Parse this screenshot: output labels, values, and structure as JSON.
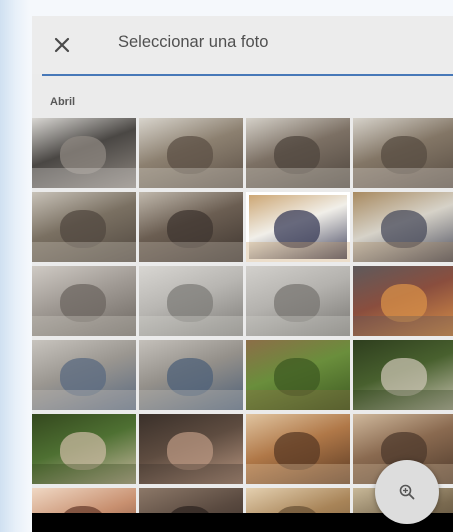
{
  "header": {
    "title": "Seleccionar una foto"
  },
  "section": {
    "month": "Abril"
  },
  "icons": {
    "close": "close-icon",
    "zoom": "zoom-in-icon"
  },
  "colors": {
    "divider": "#4778b8",
    "background": "#ebebeb"
  },
  "photos": [
    {
      "name": "photo-cat-on-floor",
      "selected": false,
      "colors": [
        "#4a4744",
        "#8e8780",
        "#d9d7d3"
      ]
    },
    {
      "name": "photo-cat-sleeping",
      "selected": false,
      "colors": [
        "#8c8070",
        "#5c5046",
        "#d8d4cc"
      ]
    },
    {
      "name": "photo-cat-on-blanket",
      "selected": false,
      "colors": [
        "#7c7064",
        "#4f463e",
        "#d4d0c8"
      ]
    },
    {
      "name": "photo-cat-resting",
      "selected": false,
      "colors": [
        "#837666",
        "#574c42",
        "#d6d2ca"
      ]
    },
    {
      "name": "photo-cat-lying",
      "selected": false,
      "colors": [
        "#7a7062",
        "#514840",
        "#c8c2b8"
      ]
    },
    {
      "name": "photo-cat-closeup",
      "selected": false,
      "colors": [
        "#6b5e52",
        "#3f3630",
        "#c0b8ac"
      ]
    },
    {
      "name": "photo-drawing-on-paper",
      "selected": true,
      "colors": [
        "#f1efe9",
        "#3a3c58",
        "#c9a06a"
      ]
    },
    {
      "name": "photo-drawing-figures",
      "selected": false,
      "colors": [
        "#d6d2c8",
        "#4a4c5c",
        "#a88a60"
      ]
    },
    {
      "name": "photo-room-doorway",
      "selected": false,
      "colors": [
        "#a09a94",
        "#6c6660",
        "#cfcac4"
      ]
    },
    {
      "name": "photo-window-blinds",
      "selected": false,
      "colors": [
        "#b8b6b2",
        "#7e7c78",
        "#d8d6d2"
      ]
    },
    {
      "name": "photo-window-blinds-2",
      "selected": false,
      "colors": [
        "#b4b2ae",
        "#787672",
        "#d2d0cc"
      ]
    },
    {
      "name": "photo-shelf-items",
      "selected": false,
      "colors": [
        "#8a4e3e",
        "#d89048",
        "#5e5a5c"
      ]
    },
    {
      "name": "photo-person-bending",
      "selected": false,
      "colors": [
        "#9a9690",
        "#5a6a80",
        "#c8c4be"
      ]
    },
    {
      "name": "photo-person-cleaning",
      "selected": false,
      "colors": [
        "#94908a",
        "#4e6078",
        "#c4c0ba"
      ]
    },
    {
      "name": "photo-plant-leaves",
      "selected": false,
      "colors": [
        "#6a8e3c",
        "#3e5a22",
        "#8c6e48"
      ]
    },
    {
      "name": "photo-plant-closeup",
      "selected": false,
      "colors": [
        "#48602e",
        "#c8c2b0",
        "#2e3e1e"
      ]
    },
    {
      "name": "photo-cat-in-grass",
      "selected": false,
      "colors": [
        "#4e7032",
        "#c8b8a0",
        "#34481e"
      ]
    },
    {
      "name": "photo-items-on-table",
      "selected": false,
      "colors": [
        "#5e4c40",
        "#b89680",
        "#3a302a"
      ]
    },
    {
      "name": "photo-person-with-dish",
      "selected": false,
      "colors": [
        "#b07848",
        "#5a3a24",
        "#e0c4a0"
      ]
    },
    {
      "name": "photo-dog-on-bed",
      "selected": false,
      "colors": [
        "#8a6a50",
        "#4e3a2c",
        "#cfb89c"
      ]
    },
    {
      "name": "photo-woman-portrait",
      "selected": false,
      "colors": [
        "#c89070",
        "#6a3e2e",
        "#f0d8c4"
      ]
    },
    {
      "name": "photo-dark-room",
      "selected": false,
      "colors": [
        "#5a4a40",
        "#2e2420",
        "#8c7868"
      ]
    },
    {
      "name": "photo-plates-on-table",
      "selected": false,
      "colors": [
        "#a88458",
        "#6a5236",
        "#e4d0b0"
      ]
    },
    {
      "name": "photo-food-dish",
      "selected": false,
      "colors": [
        "#7a6a50",
        "#443a2c",
        "#c8b898"
      ]
    }
  ]
}
